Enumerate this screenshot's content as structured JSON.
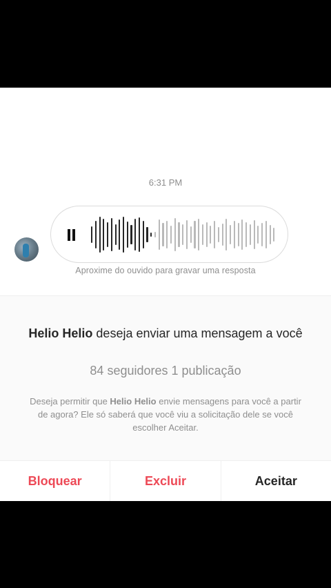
{
  "chat": {
    "timestamp": "6:31 PM",
    "voice_hint": "Aproxime do ouvido para gravar uma resposta",
    "voice_message": {
      "state": "playing",
      "icon": "pause-icon",
      "played_color": "#262626",
      "unplayed_color": "#b9b9b9",
      "progress": 0.34
    }
  },
  "request": {
    "sender_name": "Helio Helio",
    "title_rest": " deseja enviar uma mensagem a você",
    "stats": "84 seguidores 1 publicação",
    "body_prefix": "Deseja permitir que ",
    "body_name": "Helio Helio",
    "body_suffix": " envie mensagens para você a partir de agora? Ele só saberá que você viu a solicitação dele se você escolher Aceitar."
  },
  "actions": {
    "block_label": "Bloquear",
    "delete_label": "Excluir",
    "accept_label": "Aceitar"
  },
  "colors": {
    "danger": "#ed4956",
    "text_primary": "#262626",
    "text_secondary": "#8e8e8e"
  }
}
